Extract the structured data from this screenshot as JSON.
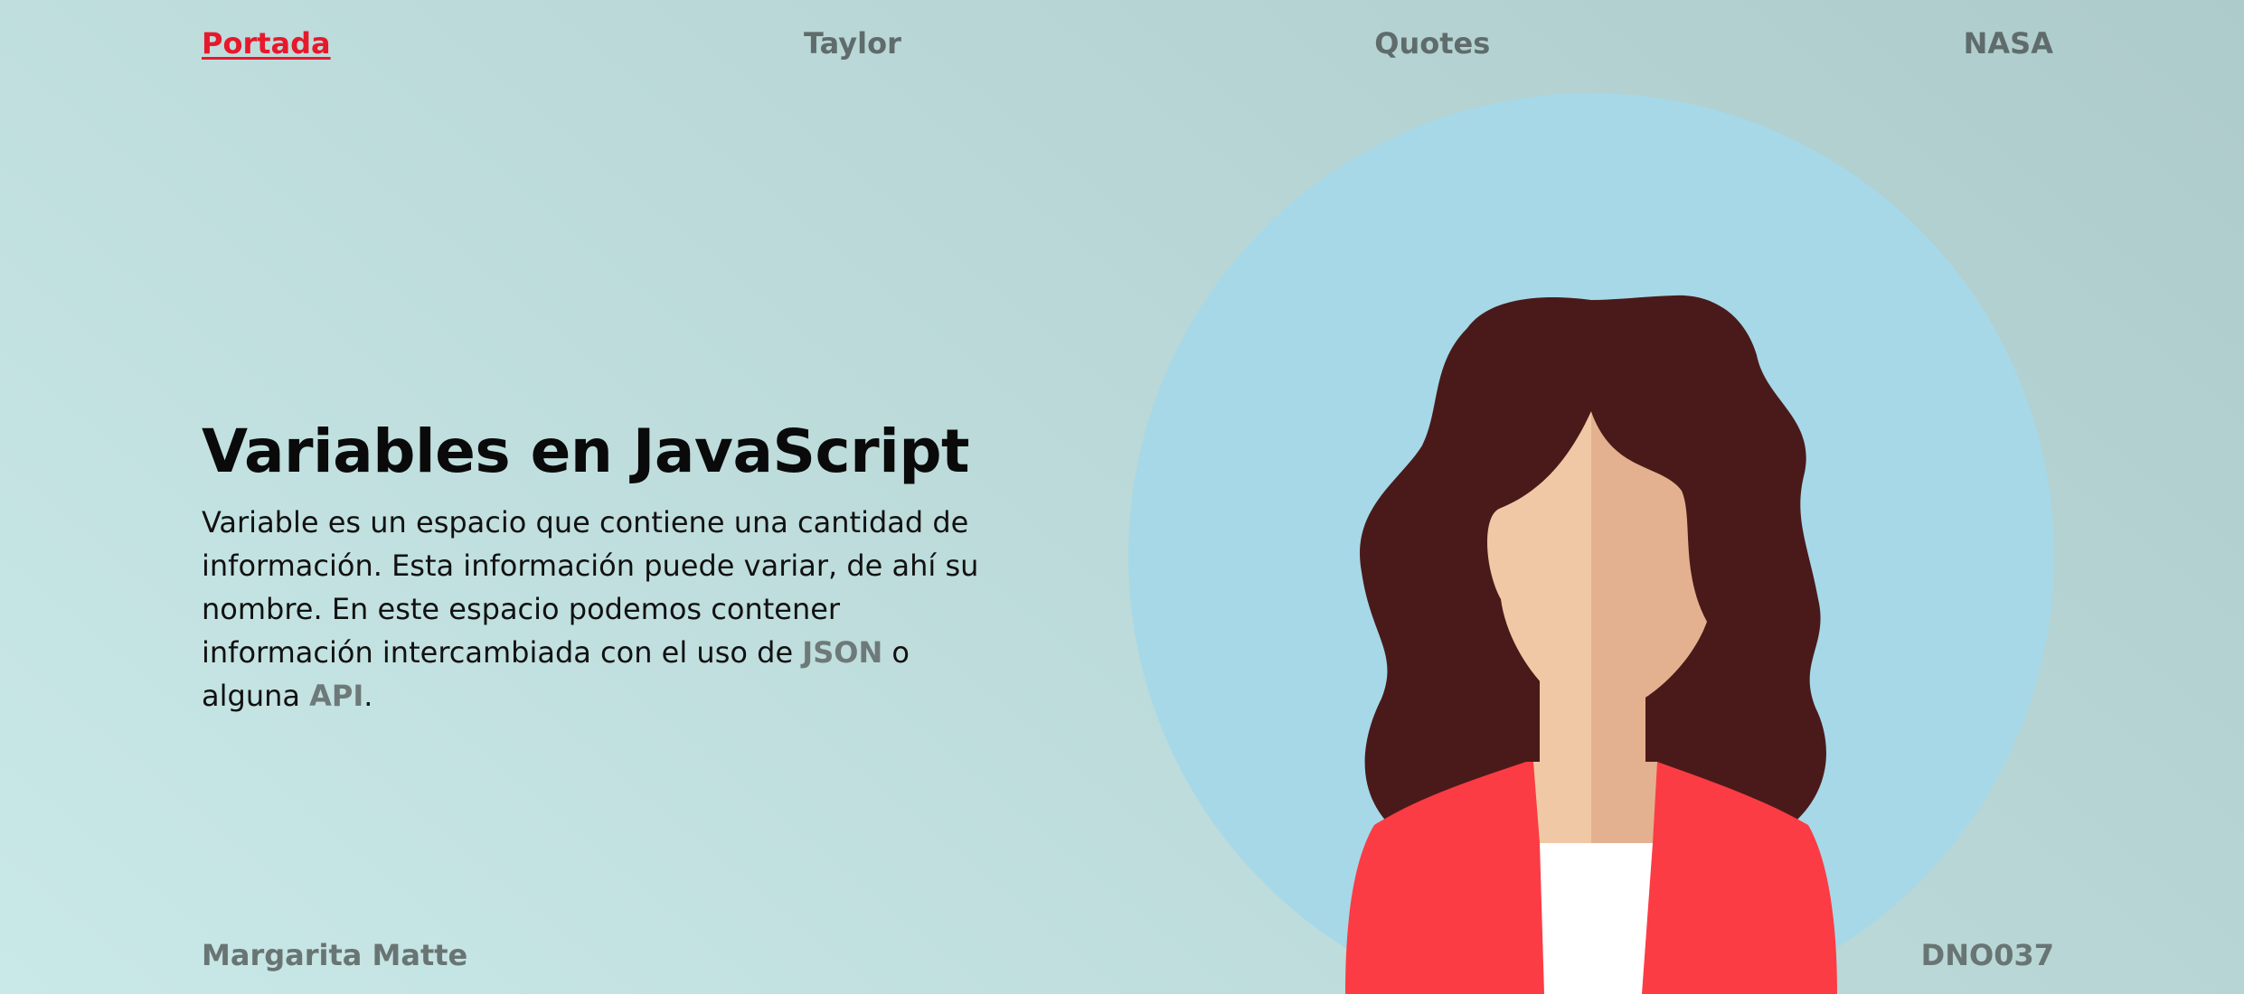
{
  "nav": {
    "items": [
      {
        "label": "Portada",
        "active": true
      },
      {
        "label": "Taylor",
        "active": false
      },
      {
        "label": "Quotes",
        "active": false
      },
      {
        "label": "NASA",
        "active": false
      }
    ]
  },
  "hero": {
    "title": "Variables en JavaScript",
    "text_before": "Variable es un espacio que contiene una cantidad de información. Esta información puede variar, de ahí su nombre. En este espacio podemos contener información intercambiada con el uso de ",
    "json_link": "JSON",
    "text_middle": " o alguna ",
    "api_link": "API",
    "text_end": "."
  },
  "avatar": {
    "icon": "woman-avatar-illustration",
    "colors": {
      "circle": "#a6d8e8",
      "hair": "#4a1a1a",
      "skin_light": "#f1c8a5",
      "skin_shadow": "#e3b18f",
      "jacket": "#fb3c44",
      "shirt": "#ffffff"
    }
  },
  "footer": {
    "author": "Margarita Matte",
    "code": "DNO037"
  },
  "colors": {
    "active_nav": "#e8182c",
    "nav_text": "#5f6c6b",
    "background_start": "#c9e8e8",
    "background_end": "#aecbcb"
  }
}
